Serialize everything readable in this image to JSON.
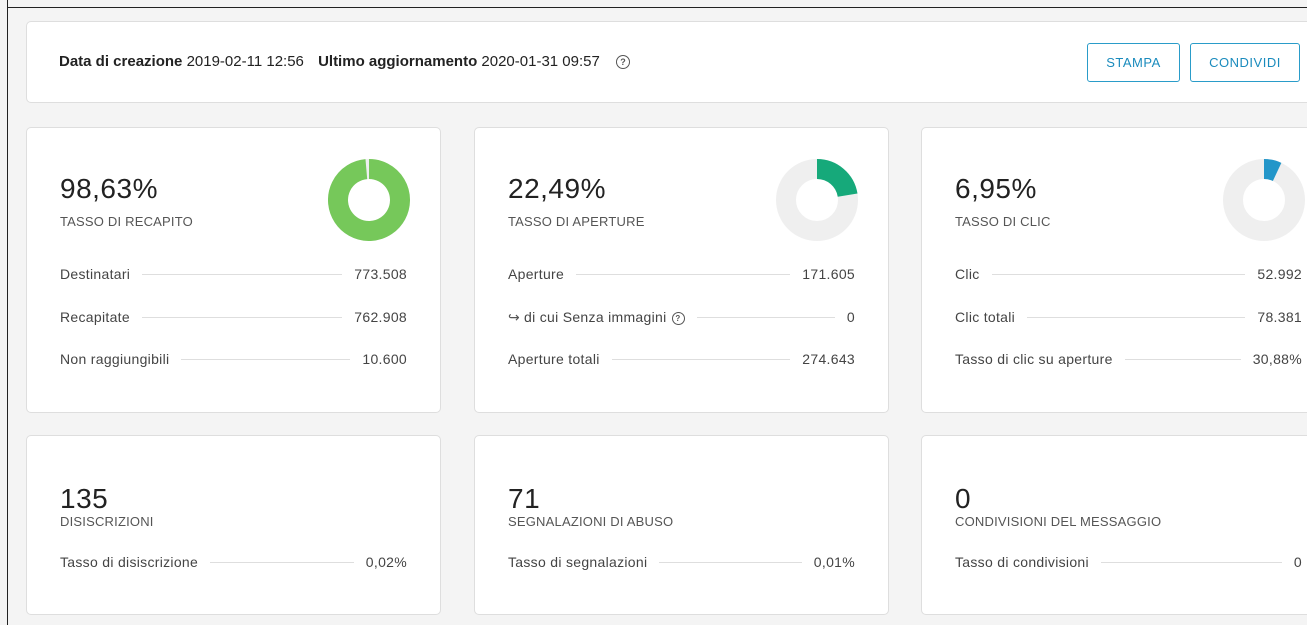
{
  "header": {
    "created_label": "Data di creazione",
    "created_value": "2019-02-11 12:56",
    "updated_label": "Ultimo aggiornamento",
    "updated_value": "2020-01-31 09:57",
    "help_glyph": "?",
    "print_label": "STAMPA",
    "share_label": "CONDIVIDI"
  },
  "colors": {
    "delivery": "#76c85a",
    "opens": "#16a97a",
    "clicks": "#2396c9",
    "donut_bg": "#efefef",
    "button": "#2a9cc9"
  },
  "cards": {
    "delivery": {
      "value": "98,63%",
      "label": "TASSO DI RECAPITO",
      "rate": 98.63,
      "rows": [
        {
          "label": "Destinatari",
          "value": "773.508"
        },
        {
          "label": "Recapitate",
          "value": "762.908"
        },
        {
          "label": "Non raggiungibili",
          "value": "10.600"
        }
      ]
    },
    "opens": {
      "value": "22,49%",
      "label": "TASSO DI APERTURE",
      "rate": 22.49,
      "rows": [
        {
          "label": "Aperture",
          "value": "171.605"
        },
        {
          "label": "di cui Senza immagini",
          "value": "0"
        },
        {
          "label": "Aperture totali",
          "value": "274.643"
        }
      ]
    },
    "clicks": {
      "value": "6,95%",
      "label": "TASSO DI CLIC",
      "rate": 6.95,
      "rows": [
        {
          "label": "Clic",
          "value": "52.992"
        },
        {
          "label": "Clic totali",
          "value": "78.381"
        },
        {
          "label": "Tasso di clic su aperture",
          "value": "30,88%"
        }
      ]
    },
    "unsubscribes": {
      "value": "135",
      "label": "DISISCRIZIONI",
      "row": {
        "label": "Tasso di disiscrizione",
        "value": "0,02%"
      }
    },
    "abuse": {
      "value": "71",
      "label": "SEGNALAZIONI DI ABUSO",
      "row": {
        "label": "Tasso di segnalazioni",
        "value": "0,01%"
      }
    },
    "shares": {
      "value": "0",
      "label": "CONDIVISIONI DEL MESSAGGIO",
      "row": {
        "label": "Tasso di condivisioni",
        "value": "0"
      }
    }
  }
}
